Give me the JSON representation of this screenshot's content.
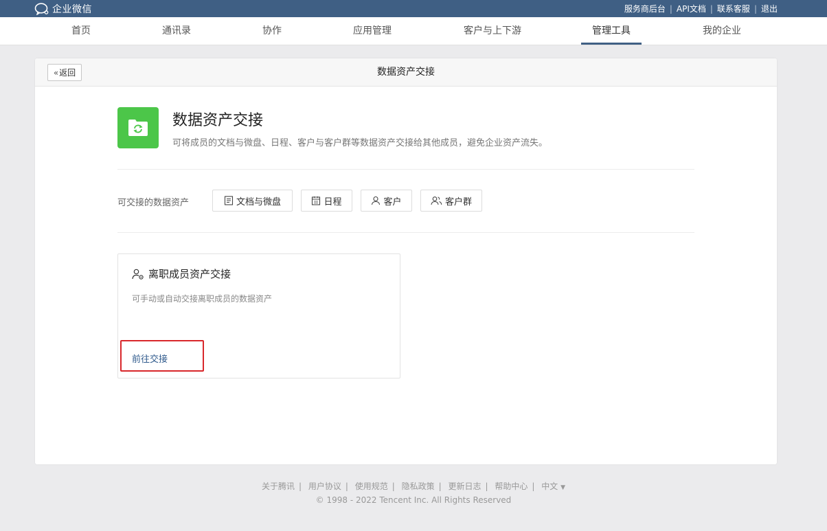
{
  "topbar": {
    "logo_text": "企业微信",
    "links": [
      "服务商后台",
      "API文档",
      "联系客服",
      "退出"
    ]
  },
  "nav": {
    "items": [
      "首页",
      "通讯录",
      "协作",
      "应用管理",
      "客户与上下游",
      "管理工具",
      "我的企业"
    ],
    "active": "管理工具"
  },
  "panel": {
    "back_label": "返回",
    "title": "数据资产交接"
  },
  "app": {
    "title": "数据资产交接",
    "description": "可将成员的文档与微盘、日程、客户与客户群等数据资产交接给其他成员，避免企业资产流失。",
    "icon_color": "#4cc649"
  },
  "assets": {
    "label": "可交接的数据资产",
    "tags": [
      {
        "label": "文档与微盘",
        "icon": "document-icon"
      },
      {
        "label": "日程",
        "icon": "calendar-icon"
      },
      {
        "label": "客户",
        "icon": "person-icon"
      },
      {
        "label": "客户群",
        "icon": "group-icon"
      }
    ]
  },
  "card": {
    "title": "离职成员资产交接",
    "description": "可手动或自动交接离职成员的数据资产",
    "link_label": "前往交接",
    "highlight_color": "#d8262a"
  },
  "footer": {
    "links": [
      "关于腾讯",
      "用户协议",
      "使用规范",
      "隐私政策",
      "更新日志",
      "帮助中心"
    ],
    "language": "中文",
    "copyright": "© 1998 - 2022 Tencent Inc. All Rights Reserved"
  },
  "colors": {
    "topbar": "#3f5f84",
    "link": "#2f5a8c"
  }
}
